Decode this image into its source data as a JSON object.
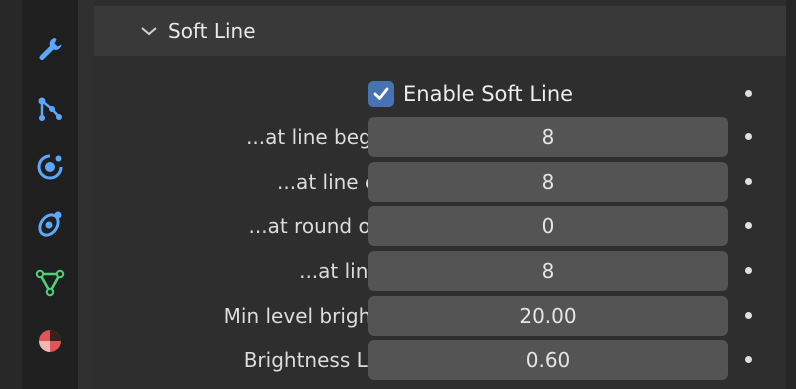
{
  "sidebar": {
    "tabs": [
      {
        "icon": "wrench-icon",
        "color": "#5aa9ff"
      },
      {
        "icon": "particles-icon",
        "color": "#5aa9ff"
      },
      {
        "icon": "physics-icon",
        "color": "#5aa9ff"
      },
      {
        "icon": "constraints-icon",
        "color": "#5aa9ff"
      },
      {
        "icon": "object-data-icon",
        "color": "#4fd17a"
      },
      {
        "icon": "material-icon",
        "color": "#e25555"
      }
    ]
  },
  "panel": {
    "title": "Soft Line",
    "collapse_icon": "chevron-down-icon",
    "enable": {
      "label": "Enable Soft Line",
      "checked": true,
      "accent": "#4772b3"
    },
    "fields": [
      {
        "label": "...at line beginnings",
        "value": "8"
      },
      {
        "label": "...at line endings",
        "value": "8"
      },
      {
        "label": "...at round overlaps",
        "value": "0"
      },
      {
        "label": "...at line Angle",
        "value": "8"
      },
      {
        "label": "Min level brightness...",
        "value": "20.00"
      },
      {
        "label": "Brightness Linearity",
        "value": "0.60"
      }
    ]
  }
}
